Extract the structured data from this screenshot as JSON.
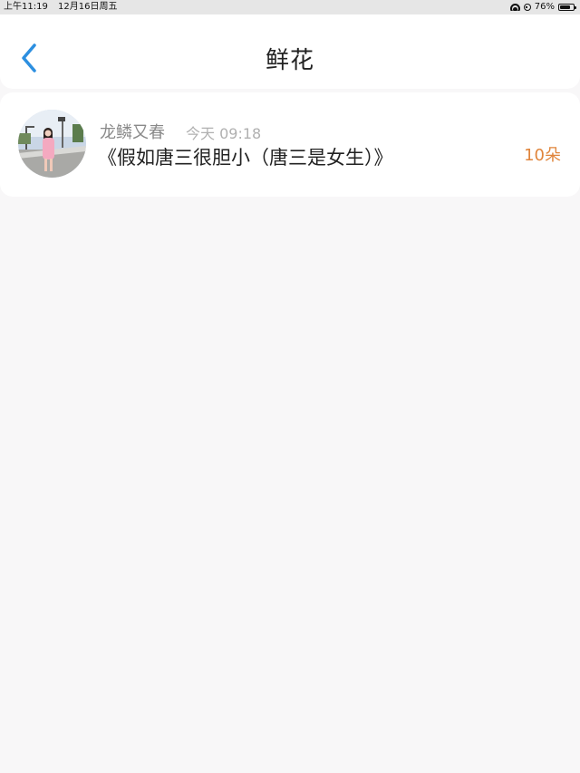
{
  "status_bar": {
    "time": "上午11:19",
    "date": "12月16日周五",
    "battery": "76%",
    "battery_level": 0.76
  },
  "header": {
    "title": "鲜花",
    "back_icon": "chevron-left-icon",
    "accent_color": "#2c8fe0"
  },
  "records": [
    {
      "username": "龙鳞又春",
      "time": "今天 09:18",
      "book_title": "《假如唐三很胆小（唐三是女生）》",
      "count": "10朵",
      "count_color": "#e0853c"
    }
  ]
}
